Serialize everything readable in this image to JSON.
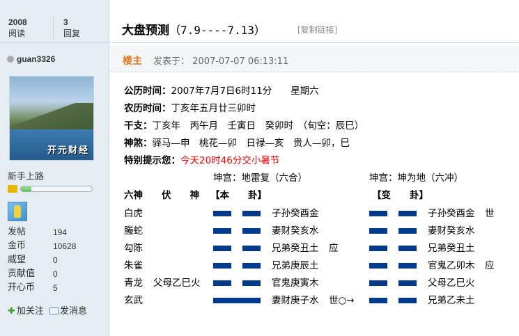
{
  "thread": {
    "read_count": "2008",
    "read_label": "阅读",
    "reply_count": "3",
    "reply_label": "回复",
    "title_main": "大盘预测",
    "title_range": "（7.9----7.13）",
    "copy_link": "[复制链接]"
  },
  "author": {
    "name": "guan3326",
    "avatar_caption": "开元财经",
    "rank": "新手上路",
    "rank_progress": 0.15,
    "stats": [
      {
        "label": "发帖",
        "value": "194"
      },
      {
        "label": "金币",
        "value": "10628"
      },
      {
        "label": "威望",
        "value": "0"
      },
      {
        "label": "贡献值",
        "value": "0"
      },
      {
        "label": "开心币",
        "value": "5"
      }
    ],
    "follow_label": "加关注",
    "message_label": "发消息"
  },
  "post": {
    "floor": "楼主",
    "posted_prefix": "发表于：",
    "posted_time": "2007-07-07 06:13:11",
    "lines": [
      {
        "key": "公历时间：",
        "text": "2007年7月7日6时11分　　星期六"
      },
      {
        "key": "农历时间：",
        "text": "丁亥年五月廿三卯时"
      },
      {
        "key": "干支：",
        "text": "丁亥年　丙午月　壬寅日　癸卯时　（旬空：辰巳）"
      },
      {
        "key": "神煞：",
        "text": "驿马—申　桃花—卯　日禄—亥　贵人—卯，巳"
      },
      {
        "key": "特别提示您：",
        "text": "今天20时46分交小暑节"
      }
    ],
    "left_palace": "坤宫：地雷复（六合）",
    "right_palace": "坤宫：坤为地（六冲）",
    "head_liushen": "六神",
    "head_fushen": "伏　　神",
    "head_ben": "【本　　卦】",
    "head_bian": "【变　　卦】",
    "rows": [
      {
        "god": "白虎",
        "fu": "",
        "ben": "子孙癸酉金",
        "ben_mark": "",
        "bian": "子孙癸酉金",
        "bian_mark": "世"
      },
      {
        "god": "螣蛇",
        "fu": "",
        "ben": "妻财癸亥水",
        "ben_mark": "",
        "bian": "妻财癸亥水",
        "bian_mark": ""
      },
      {
        "god": "勾陈",
        "fu": "",
        "ben": "兄弟癸丑土",
        "ben_mark": "应",
        "bian": "兄弟癸丑土",
        "bian_mark": ""
      },
      {
        "god": "朱雀",
        "fu": "",
        "ben": "兄弟庚辰土",
        "ben_mark": "",
        "bian": "官鬼乙卯木",
        "bian_mark": "应"
      },
      {
        "god": "青龙",
        "fu": "父母乙巳火",
        "ben": "官鬼庚寅木",
        "ben_mark": "",
        "bian": "父母乙巳火",
        "bian_mark": ""
      },
      {
        "god": "玄武",
        "fu": "",
        "ben": "妻财庚子水",
        "ben_mark": "世○→",
        "bian": "兄弟乙未土",
        "bian_mark": ""
      }
    ],
    "ben_lines": [
      "broken",
      "broken",
      "broken",
      "broken",
      "broken",
      "solid"
    ],
    "bian_lines": [
      "broken",
      "broken",
      "broken",
      "broken",
      "broken",
      "broken"
    ]
  },
  "colors": {
    "sidebar_bg": "#e5edf2",
    "border": "#c2d5e3",
    "floor_label": "#e0771f",
    "alert": "#ee0000",
    "yao": "#003a8c"
  }
}
